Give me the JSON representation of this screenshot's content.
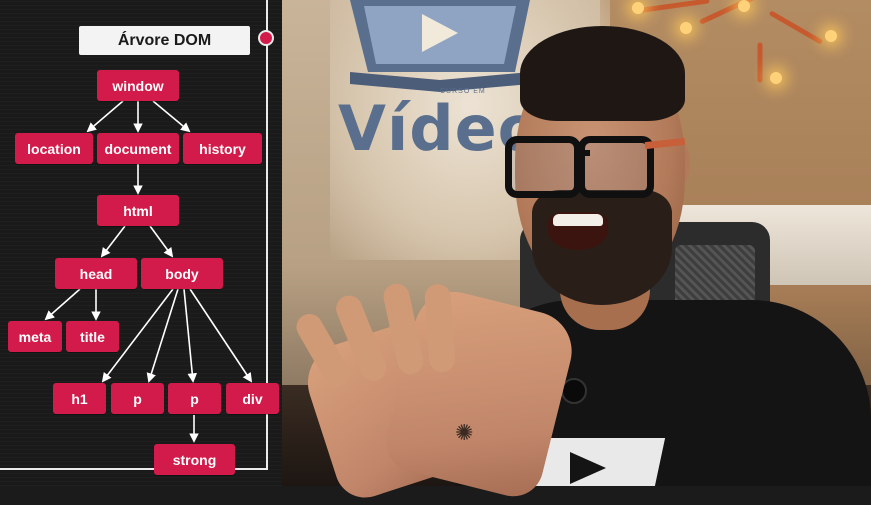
{
  "panel": {
    "title": "Árvore DOM",
    "accent": "#d21b4a",
    "nodes": {
      "window": "window",
      "location": "location",
      "document": "document",
      "history": "history",
      "html": "html",
      "head": "head",
      "body": "body",
      "meta": "meta",
      "title": "title",
      "h1": "h1",
      "p1": "p",
      "p2": "p",
      "div": "div",
      "strong": "strong"
    }
  },
  "scene": {
    "sign_text": "Vídeo",
    "sign_small_text": "CURSO EM"
  }
}
